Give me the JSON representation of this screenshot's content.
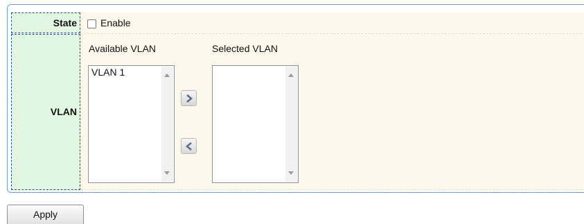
{
  "state": {
    "label": "State",
    "checkbox_label": "Enable",
    "checked": false
  },
  "vlan": {
    "label": "VLAN",
    "available_title": "Available VLAN",
    "selected_title": "Selected VLAN",
    "available_items": [
      "VLAN 1"
    ],
    "selected_items": []
  },
  "actions": {
    "move_right_icon": "chevron-right-icon",
    "move_left_icon": "chevron-left-icon",
    "apply_label": "Apply"
  },
  "colors": {
    "frame_border": "#6e9fd0",
    "label_bg": "#e2f7e2",
    "label_border": "#1d4e8c",
    "row_bg": "#fdf8ec"
  }
}
